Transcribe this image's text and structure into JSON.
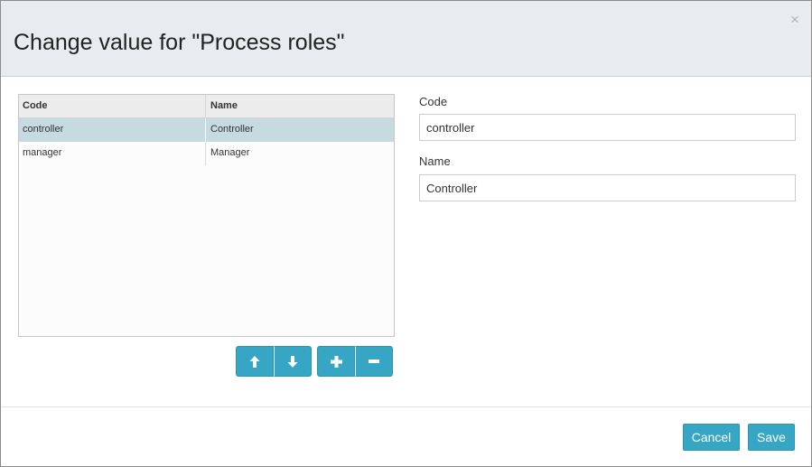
{
  "dialog": {
    "title": "Change value for \"Process roles\"",
    "close_label": "×"
  },
  "grid": {
    "columns": [
      "Code",
      "Name"
    ],
    "rows": [
      {
        "code": "controller",
        "name": "Controller",
        "selected": true
      },
      {
        "code": "manager",
        "name": "Manager",
        "selected": false
      }
    ]
  },
  "toolbar": {
    "buttons": [
      {
        "icon": "arrow-up-icon"
      },
      {
        "icon": "arrow-down-icon"
      },
      {
        "icon": "plus-icon"
      },
      {
        "icon": "minus-icon"
      }
    ]
  },
  "form": {
    "code_label": "Code",
    "code_value": "controller",
    "name_label": "Name",
    "name_value": "Controller"
  },
  "footer": {
    "cancel_label": "Cancel",
    "save_label": "Save"
  },
  "colors": {
    "accent": "#36a6c4",
    "selected_row": "#c5dbe0",
    "header_bg": "#e8ecf0"
  }
}
